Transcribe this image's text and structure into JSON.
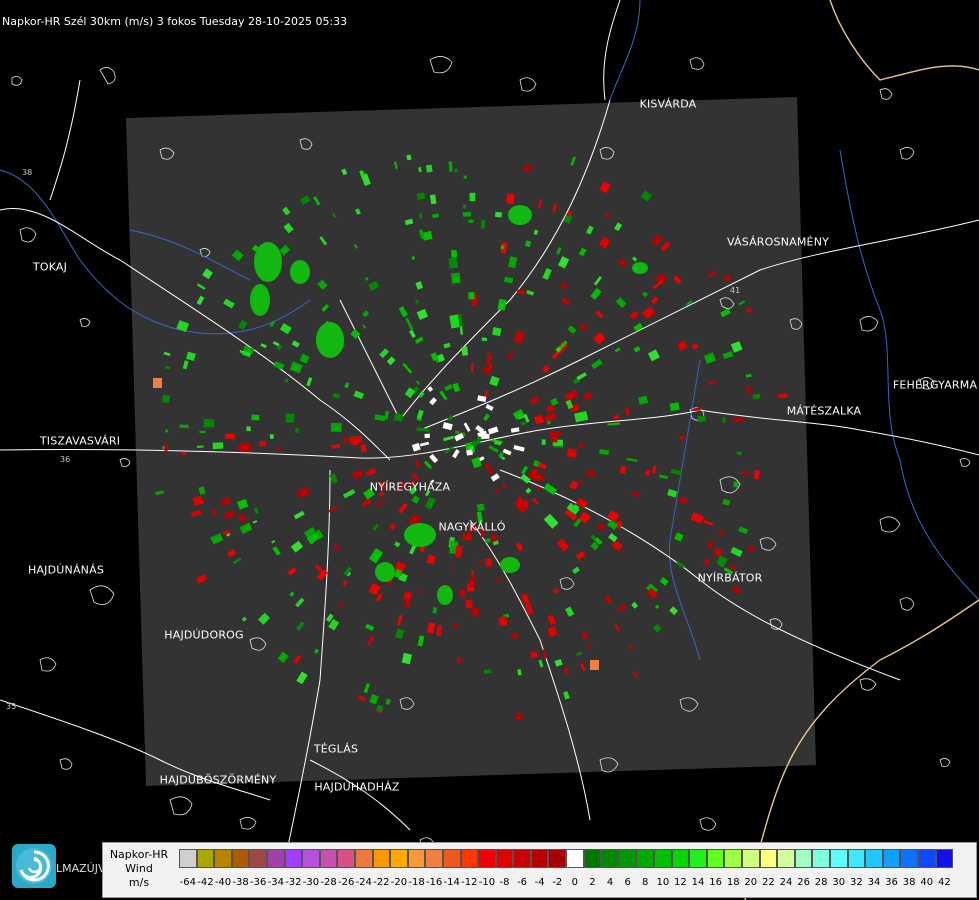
{
  "header": {
    "title": "Napkor-HR Szél 30km (m/s) 3 fokos Tuesday 28-10-2025 05:33"
  },
  "cities": [
    {
      "id": "kisvarda",
      "name": "KISVÁRDA"
    },
    {
      "id": "tokaj",
      "name": "TOKAJ"
    },
    {
      "id": "vasarosnameny",
      "name": "VÁSÁROSNAMÉNY"
    },
    {
      "id": "fehergyarmat",
      "name": "FEHÉRGYARMA"
    },
    {
      "id": "mateszalka",
      "name": "MÁTÉSZALKA"
    },
    {
      "id": "tiszavasvari",
      "name": "TISZAVASVÁRI"
    },
    {
      "id": "nyiregyhaza",
      "name": "NYÍREGYHÁZA"
    },
    {
      "id": "nagykallo",
      "name": "NAGYKÁLLÓ"
    },
    {
      "id": "nyirbator",
      "name": "NYÍRBÁTOR"
    },
    {
      "id": "hajdunanas",
      "name": "HAJDÚNÁNÁS"
    },
    {
      "id": "hajdudorog",
      "name": "HAJDÚDOROG"
    },
    {
      "id": "teglas",
      "name": "TÉGLÁS"
    },
    {
      "id": "hajduboszormeny",
      "name": "HAJDÚBÖSZÖRMÉNY"
    },
    {
      "id": "hajduhadhaz",
      "name": "HAJDÚHADHÁZ"
    }
  ],
  "road_numbers": [
    "38",
    "41",
    "36",
    "35"
  ],
  "legend": {
    "line1": "Napkor-HR",
    "line2": "Wind",
    "line3": "m/s",
    "brand": "LMAZÚJVÁR",
    "ticks": [
      "-64",
      "-42",
      "-40",
      "-38",
      "-36",
      "-34",
      "-32",
      "-30",
      "-28",
      "-26",
      "-24",
      "-22",
      "-20",
      "-18",
      "-16",
      "-14",
      "-12",
      "-10",
      "-8",
      "-6",
      "-4",
      "-2",
      "0",
      "2",
      "4",
      "6",
      "8",
      "10",
      "12",
      "14",
      "16",
      "18",
      "20",
      "22",
      "24",
      "26",
      "28",
      "30",
      "32",
      "34",
      "36",
      "38",
      "40",
      "42"
    ],
    "colors": [
      "#cfcfcf",
      "#a8a800",
      "#b88400",
      "#b05a00",
      "#a04848",
      "#a040a8",
      "#a040ff",
      "#b850e0",
      "#c850b0",
      "#d85088",
      "#f07840",
      "#ff9800",
      "#ffa800",
      "#f89838",
      "#f08040",
      "#f05820",
      "#ff3800",
      "#f00000",
      "#e00000",
      "#c80000",
      "#b80000",
      "#a80000",
      "#ffffff",
      "#007800",
      "#008800",
      "#009800",
      "#00a800",
      "#00c000",
      "#00d800",
      "#20f020",
      "#60ff20",
      "#a0ff40",
      "#d0ff80",
      "#ffff80",
      "#d0ffa0",
      "#a0ffc0",
      "#80ffe0",
      "#60ffff",
      "#40e8ff",
      "#20c8ff",
      "#10a0ff",
      "#1070ff",
      "#1048ff",
      "#1010f0"
    ]
  }
}
